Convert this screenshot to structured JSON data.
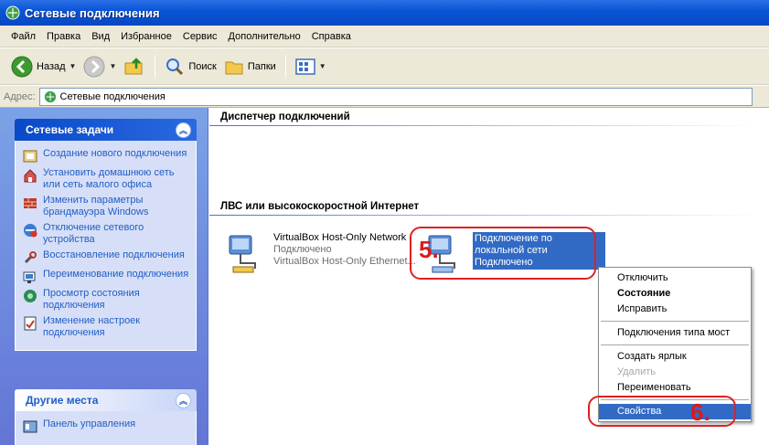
{
  "window": {
    "title": "Сетевые подключения"
  },
  "menubar": {
    "items": [
      "Файл",
      "Правка",
      "Вид",
      "Избранное",
      "Сервис",
      "Дополнительно",
      "Справка"
    ]
  },
  "toolbar": {
    "back_label": "Назад",
    "search_label": "Поиск",
    "folders_label": "Папки"
  },
  "address": {
    "label": "Адрес:",
    "value": "Сетевые подключения"
  },
  "sidebar": {
    "network_tasks": {
      "title": "Сетевые задачи",
      "items": [
        {
          "label": "Создание нового подключения",
          "icon": "new-connection-icon"
        },
        {
          "label": "Установить домашнюю сеть или сеть малого офиса",
          "icon": "home-network-icon"
        },
        {
          "label": "Изменить параметры брандмауэра Windows",
          "icon": "firewall-icon"
        },
        {
          "label": "Отключение сетевого устройства",
          "icon": "disable-device-icon"
        },
        {
          "label": "Восстановление подключения",
          "icon": "repair-icon"
        },
        {
          "label": "Переименование подключения",
          "icon": "rename-icon"
        },
        {
          "label": "Просмотр состояния подключения",
          "icon": "status-icon"
        },
        {
          "label": "Изменение настроек подключения",
          "icon": "settings-icon"
        }
      ]
    },
    "other_places": {
      "title": "Другие места",
      "items": [
        {
          "label": "Панель управления",
          "icon": "control-panel-icon"
        }
      ]
    }
  },
  "main": {
    "groups": [
      {
        "title": "Диспетчер подключений"
      },
      {
        "title": "ЛВС или высокоскоростной Интернет"
      }
    ],
    "connections": [
      {
        "name": "VirtualBox Host-Only Network",
        "status": "Подключено",
        "device": "VirtualBox Host-Only Ethernet..."
      },
      {
        "name": "Подключение по локальной сети",
        "status": "Подключено"
      }
    ]
  },
  "context_menu": {
    "items": [
      {
        "label": "Отключить"
      },
      {
        "label": "Состояние",
        "bold": true
      },
      {
        "label": "Исправить"
      },
      {
        "label": "Подключения типа мост"
      },
      {
        "label": "Создать ярлык"
      },
      {
        "label": "Удалить",
        "disabled": true
      },
      {
        "label": "Переименовать"
      },
      {
        "label": "Свойства",
        "highlighted": true
      }
    ]
  },
  "annotations": {
    "step5": "5.",
    "step6": "6."
  },
  "colors": {
    "selection": "#316ac5",
    "annotation_red": "#e02020",
    "titlebar": "#0a55d7"
  }
}
